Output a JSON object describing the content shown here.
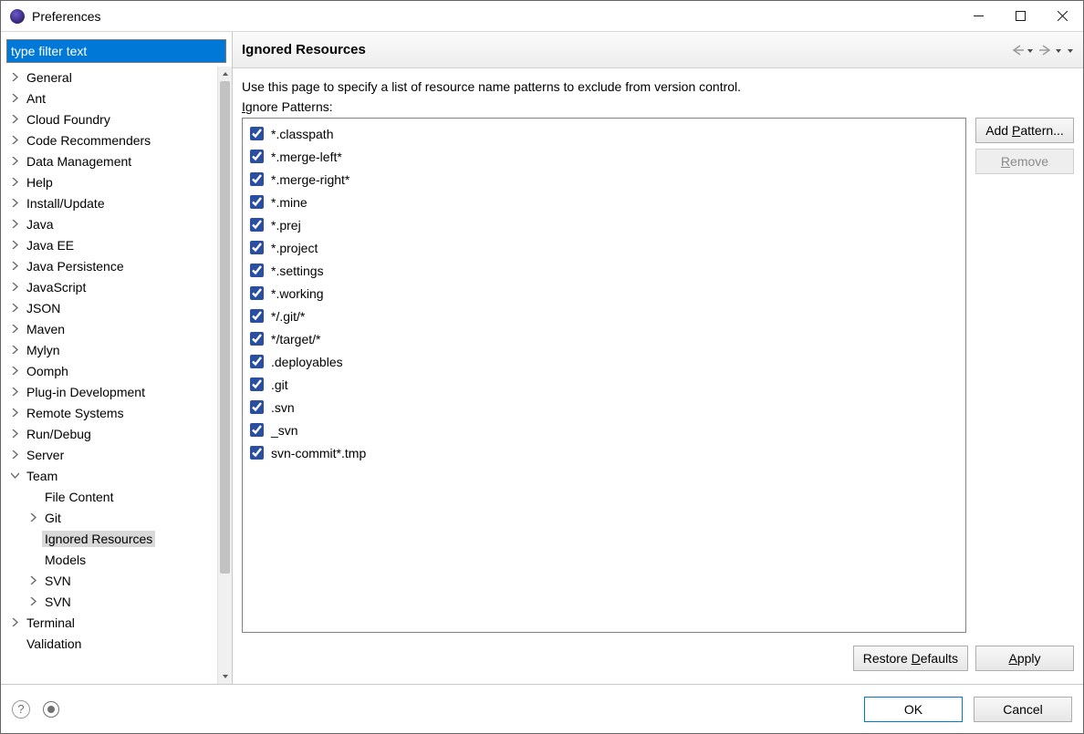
{
  "window": {
    "title": "Preferences"
  },
  "sidebar": {
    "filter_placeholder": "type filter text",
    "items": [
      {
        "label": "General",
        "depth": 0,
        "expandable": true,
        "expanded": false
      },
      {
        "label": "Ant",
        "depth": 0,
        "expandable": true,
        "expanded": false
      },
      {
        "label": "Cloud Foundry",
        "depth": 0,
        "expandable": true,
        "expanded": false
      },
      {
        "label": "Code Recommenders",
        "depth": 0,
        "expandable": true,
        "expanded": false
      },
      {
        "label": "Data Management",
        "depth": 0,
        "expandable": true,
        "expanded": false
      },
      {
        "label": "Help",
        "depth": 0,
        "expandable": true,
        "expanded": false
      },
      {
        "label": "Install/Update",
        "depth": 0,
        "expandable": true,
        "expanded": false
      },
      {
        "label": "Java",
        "depth": 0,
        "expandable": true,
        "expanded": false
      },
      {
        "label": "Java EE",
        "depth": 0,
        "expandable": true,
        "expanded": false
      },
      {
        "label": "Java Persistence",
        "depth": 0,
        "expandable": true,
        "expanded": false
      },
      {
        "label": "JavaScript",
        "depth": 0,
        "expandable": true,
        "expanded": false
      },
      {
        "label": "JSON",
        "depth": 0,
        "expandable": true,
        "expanded": false
      },
      {
        "label": "Maven",
        "depth": 0,
        "expandable": true,
        "expanded": false
      },
      {
        "label": "Mylyn",
        "depth": 0,
        "expandable": true,
        "expanded": false
      },
      {
        "label": "Oomph",
        "depth": 0,
        "expandable": true,
        "expanded": false
      },
      {
        "label": "Plug-in Development",
        "depth": 0,
        "expandable": true,
        "expanded": false
      },
      {
        "label": "Remote Systems",
        "depth": 0,
        "expandable": true,
        "expanded": false
      },
      {
        "label": "Run/Debug",
        "depth": 0,
        "expandable": true,
        "expanded": false
      },
      {
        "label": "Server",
        "depth": 0,
        "expandable": true,
        "expanded": false
      },
      {
        "label": "Team",
        "depth": 0,
        "expandable": true,
        "expanded": true
      },
      {
        "label": "File Content",
        "depth": 1,
        "expandable": false,
        "expanded": false
      },
      {
        "label": "Git",
        "depth": 1,
        "expandable": true,
        "expanded": false
      },
      {
        "label": "Ignored Resources",
        "depth": 1,
        "expandable": false,
        "expanded": false,
        "selected": true
      },
      {
        "label": "Models",
        "depth": 1,
        "expandable": false,
        "expanded": false
      },
      {
        "label": "SVN",
        "depth": 1,
        "expandable": true,
        "expanded": false
      },
      {
        "label": "SVN",
        "depth": 1,
        "expandable": true,
        "expanded": false
      },
      {
        "label": "Terminal",
        "depth": 0,
        "expandable": true,
        "expanded": false
      },
      {
        "label": "Validation",
        "depth": 0,
        "expandable": false,
        "expanded": false
      }
    ]
  },
  "page": {
    "title": "Ignored Resources",
    "description": "Use this page to specify a list of resource name patterns to exclude from version control.",
    "list_label_pre": "I",
    "list_label_post": "gnore Patterns:",
    "patterns": [
      {
        "label": "*.classpath",
        "checked": true
      },
      {
        "label": "*.merge-left*",
        "checked": true
      },
      {
        "label": "*.merge-right*",
        "checked": true
      },
      {
        "label": "*.mine",
        "checked": true
      },
      {
        "label": "*.prej",
        "checked": true
      },
      {
        "label": "*.project",
        "checked": true
      },
      {
        "label": "*.settings",
        "checked": true
      },
      {
        "label": "*.working",
        "checked": true
      },
      {
        "label": "*/.git/*",
        "checked": true
      },
      {
        "label": "*/target/*",
        "checked": true
      },
      {
        "label": ".deployables",
        "checked": true
      },
      {
        "label": ".git",
        "checked": true
      },
      {
        "label": ".svn",
        "checked": true
      },
      {
        "label": "_svn",
        "checked": true
      },
      {
        "label": "svn-commit*.tmp",
        "checked": true
      }
    ],
    "buttons": {
      "add_pattern_pre": "Add ",
      "add_pattern_ul": "P",
      "add_pattern_post": "attern...",
      "remove_ul": "R",
      "remove_post": "emove",
      "restore_pre": "Restore ",
      "restore_ul": "D",
      "restore_post": "efaults",
      "apply_ul": "A",
      "apply_post": "pply"
    }
  },
  "footer": {
    "ok": "OK",
    "cancel": "Cancel"
  }
}
